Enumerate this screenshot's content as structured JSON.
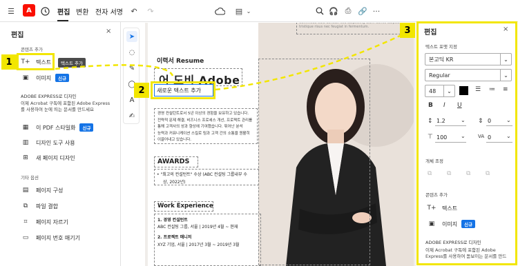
{
  "toolbar": {
    "menu_edit": "편집",
    "menu_convert": "변환",
    "menu_esign": "전자 서명"
  },
  "left_panel": {
    "title": "편집",
    "close": "×",
    "section_add_content": "콘텐츠 추가",
    "item_text": "텍스트",
    "tooltip_text": "텍스트 추가",
    "item_image": "이미지",
    "badge_new": "신규",
    "express_title": "ADOBE EXPRESS로 디자인",
    "express_desc": "이제 Acrobat 구독에 포함된 Adobe Express를 사용하여 눈에 띄는 문서를 만드세요",
    "item_stylize": "이 PDF 스타일화",
    "item_design_tools": "디자인 도구 사용",
    "item_new_page": "새 페이지 디자인",
    "section_other": "기타 옵션",
    "item_organize": "페이지 구성",
    "item_combine": "파일 결합",
    "item_crop": "페이지 자르기",
    "item_page_numbers": "페이지 번호 매기기"
  },
  "callouts": [
    "1",
    "2",
    "3"
  ],
  "document": {
    "top_fragment": "Commodo odio aenean sed adipiscing diam donec adipiscing tristique risus nec feugiat in fermentum.",
    "resume_title": "이력서 Resume",
    "name_heading": "어 도비 Adobe",
    "new_text_box": "새로운 텍스트 추가",
    "intro_lines": [
      "경영 컨설턴트로서 5년 이상의 경험을 보유하고 있습니다.",
      "전략적 문제 해결, 비즈니스 프로세스 개선, 프로젝트 관리를",
      "통해 고객사의 성과 향상에 기여했습니다. 뛰어난 분석",
      "능력과 커뮤니케이션 스킬로 팀과 고객 간의 소통을 원활히",
      "이끌어내고 있습니다."
    ],
    "awards_title": "AWARDS",
    "award_line1": "• \"최고의 컨설턴트\" 수상 (ABC 컨설팅 그룹내부 수",
    "award_line2": "상, 2022년)",
    "work_title": "Work Experience",
    "job1_title": "1. 경영 컨설턴트",
    "job1_detail": "ABC 컨설팅 그룹, 서울 | 2019년 4월 ~ 현재",
    "job2_title": "2. 프로젝트 매니저",
    "job2_detail": "XYZ 기업, 서울 | 2017년 3월 ~ 2019년 3월"
  },
  "right_panel": {
    "title": "편집",
    "close": "×",
    "section_format": "텍스트 포맷 지정",
    "font_family": "본고딕 KR",
    "font_style": "Regular",
    "font_size": "48",
    "text_color": "#000000",
    "line_spacing": "1.2",
    "paragraph_spacing": "0",
    "horizontal_scale": "100",
    "char_spacing": "0",
    "section_object": "개체 조정",
    "section_add_content": "콘텐츠 추가",
    "item_text": "텍스트",
    "item_image": "이미지",
    "badge_new": "신규",
    "express_title": "ADOBE EXPRESS로 디자인",
    "express_desc": "이제 Acrobat 구독에 포함된 Adobe Express를 사용하여 돋보이는 문서를 만드"
  },
  "colors": {
    "highlight": "#f2e600",
    "accent": "#1473e6"
  }
}
